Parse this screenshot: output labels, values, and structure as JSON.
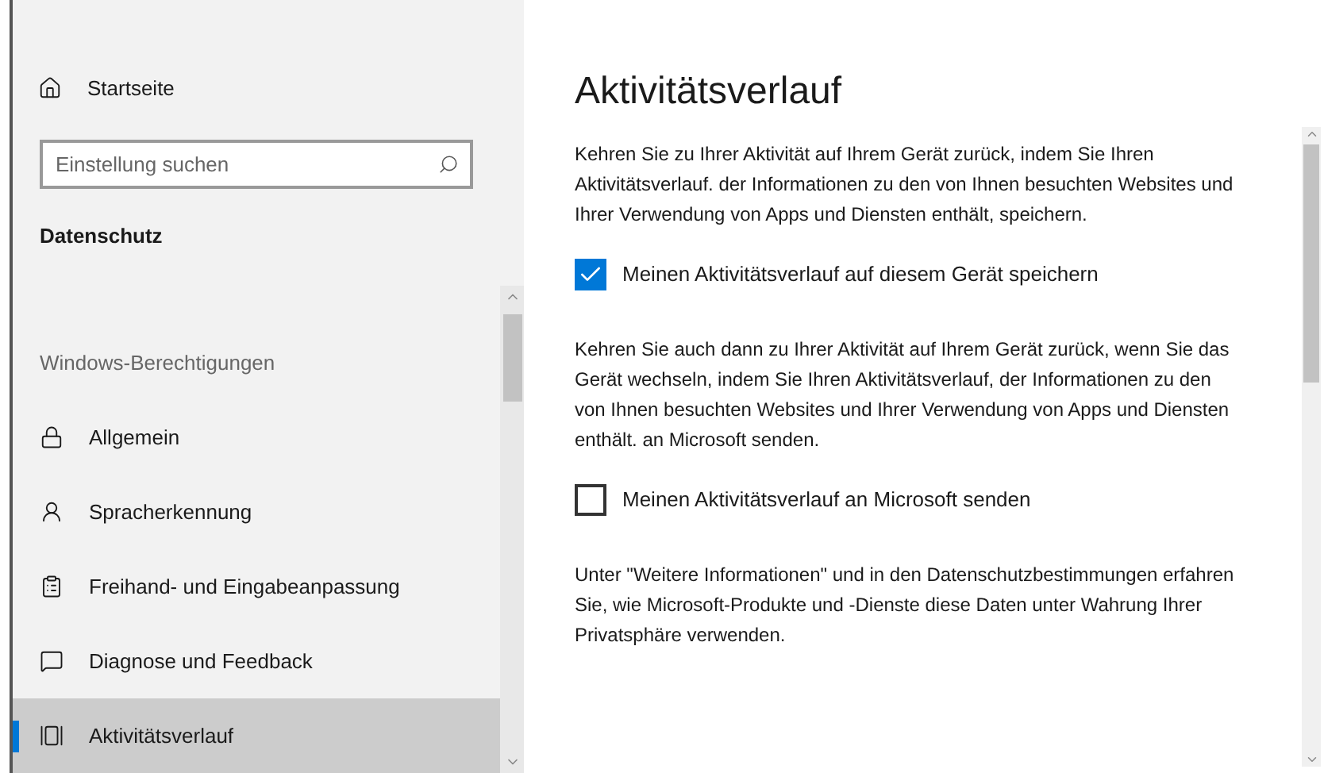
{
  "sidebar": {
    "home": {
      "label": "Startseite"
    },
    "search": {
      "placeholder": "Einstellung suchen"
    },
    "section_title": "Datenschutz",
    "group_title": "Windows-Berechtigungen",
    "items": [
      {
        "label": "Allgemein",
        "kind": "lock",
        "selected": false
      },
      {
        "label": "Spracherkennung",
        "kind": "speech",
        "selected": false
      },
      {
        "label": "Freihand- und Eingabeanpassung",
        "kind": "clipboard",
        "selected": false
      },
      {
        "label": "Diagnose und Feedback",
        "kind": "feedback",
        "selected": false
      },
      {
        "label": "Aktivitätsverlauf",
        "kind": "timeline",
        "selected": true
      }
    ]
  },
  "content": {
    "title": "Aktivitätsverlauf",
    "blocks": [
      {
        "kind": "text",
        "text": "Kehren Sie zu Ihrer Aktivität auf Ihrem Gerät zurück, indem Sie Ihren Aktivitätsverlauf. der Informationen zu den von Ihnen besuchten Websites und Ihrer Verwendung von Apps und Diensten enthält, speichern."
      },
      {
        "kind": "checkbox",
        "text": "Meinen Aktivitätsverlauf auf diesem Gerät speichern",
        "checked": true
      },
      {
        "kind": "text",
        "text": "Kehren Sie auch dann zu Ihrer Aktivität auf Ihrem Gerät zurück, wenn Sie das Gerät wechseln, indem Sie Ihren Aktivitätsverlauf, der Informationen zu den von Ihnen besuchten Websites und Ihrer Verwendung von Apps und Diensten enthält. an Microsoft senden."
      },
      {
        "kind": "checkbox",
        "text": "Meinen Aktivitätsverlauf an Microsoft senden",
        "checked": false
      },
      {
        "kind": "text",
        "text": "Unter \"Weitere Informationen\" und in den Datenschutzbestimmungen erfahren Sie, wie Microsoft-Produkte und -Dienste diese Daten unter Wahrung Ihrer Privatsphäre verwenden."
      }
    ]
  }
}
